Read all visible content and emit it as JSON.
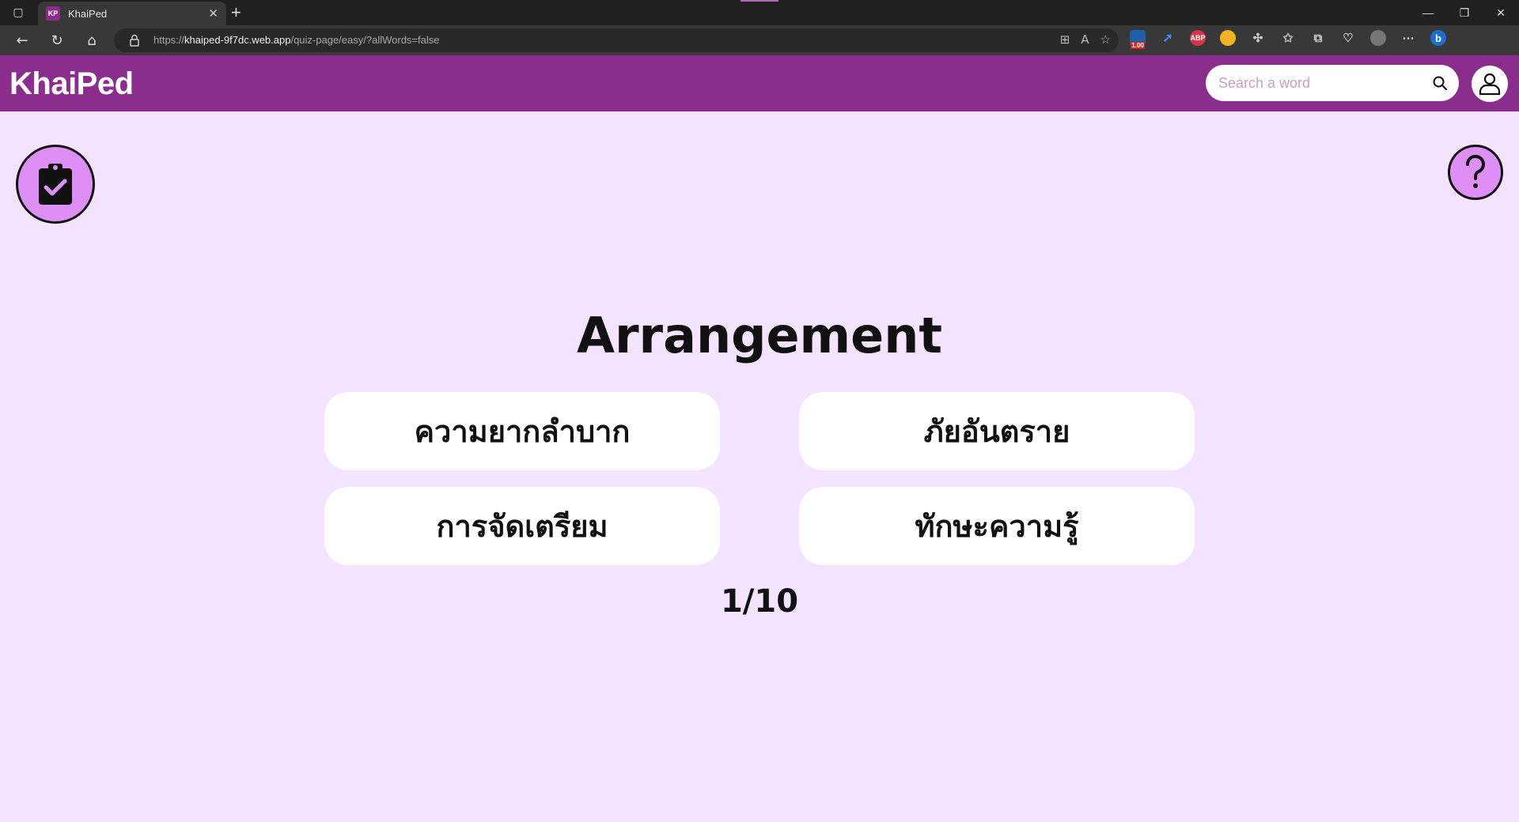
{
  "browser": {
    "tab_title": "KhaiPed",
    "favicon_text": "KP",
    "url_prefix": "https://",
    "url_domain": "khaiped-9f7dc.web.app",
    "url_path": "/quiz-page/easy/?allWords=false",
    "extension_badge": "1.00",
    "abp_label": "ABP"
  },
  "header": {
    "logo": "KhaiPed",
    "search_placeholder": "Search a word"
  },
  "quiz": {
    "word": "Arrangement",
    "options": [
      "ความยากลำบาก",
      "ภัยอันตราย",
      "การจัดเตรียม",
      "ทักษะความรู้"
    ],
    "progress": "1/10"
  },
  "colors": {
    "brand": "#8a2d8c",
    "background": "#f4e4ff",
    "accent": "#dd8ff5"
  }
}
